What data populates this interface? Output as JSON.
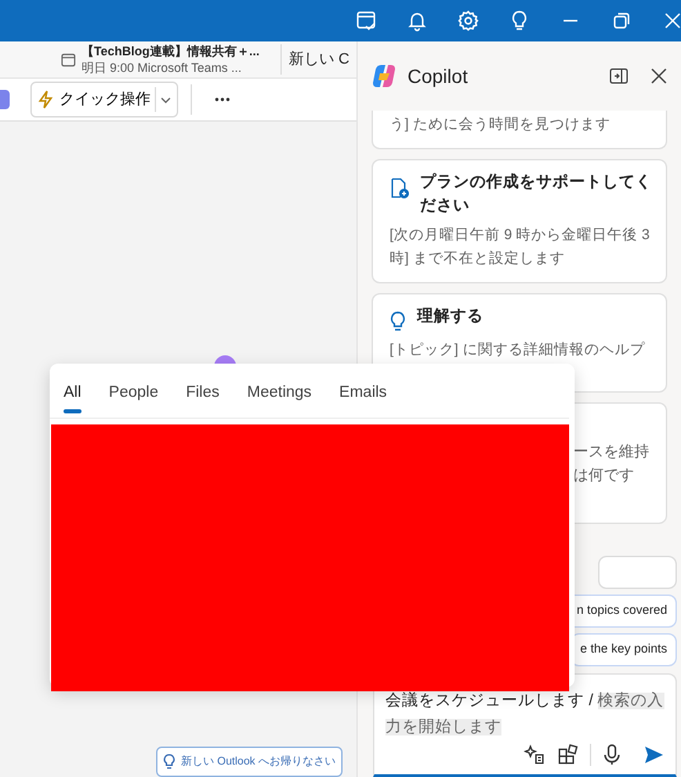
{
  "reminder": {
    "title": "【TechBlog連載】情報共有＋...",
    "detail": "明日 9:00 Microsoft Teams ..."
  },
  "new_item_label": "新しい C",
  "toolbar": {
    "quick_action": "クイック操作"
  },
  "copilot": {
    "title": "Copilot",
    "cards": [
      {
        "kind": "cut",
        "description": "う] ために会う時間を見つけます"
      },
      {
        "kind": "plan",
        "title": "プランの作成をサポートしてください",
        "description": "[次の月曜日午前 9 時から金曜日午後 3 時] まで不在と設定します"
      },
      {
        "kind": "idea",
        "title": "理解する",
        "description": "[トピック] に関する詳細情報のヘルプ"
      },
      {
        "kind": "covered",
        "lines": [
          "ースを維持",
          "は何です"
        ]
      }
    ],
    "chips": [
      {
        "highlighted": false
      },
      {
        "text": "n topics covered",
        "highlighted": true
      },
      {
        "text": "e the key points",
        "highlighted": true
      }
    ],
    "compose": {
      "text": "会議をスケジュールします / ",
      "suggestion": "検索の入力を開始します"
    }
  },
  "search_popup": {
    "tabs": [
      {
        "label": "All",
        "selected": true
      },
      {
        "label": "People",
        "selected": false
      },
      {
        "label": "Files",
        "selected": false
      },
      {
        "label": "Meetings",
        "selected": false
      },
      {
        "label": "Emails",
        "selected": false
      }
    ]
  },
  "tip": {
    "text": "新しい Outlook へお帰りなさい"
  }
}
